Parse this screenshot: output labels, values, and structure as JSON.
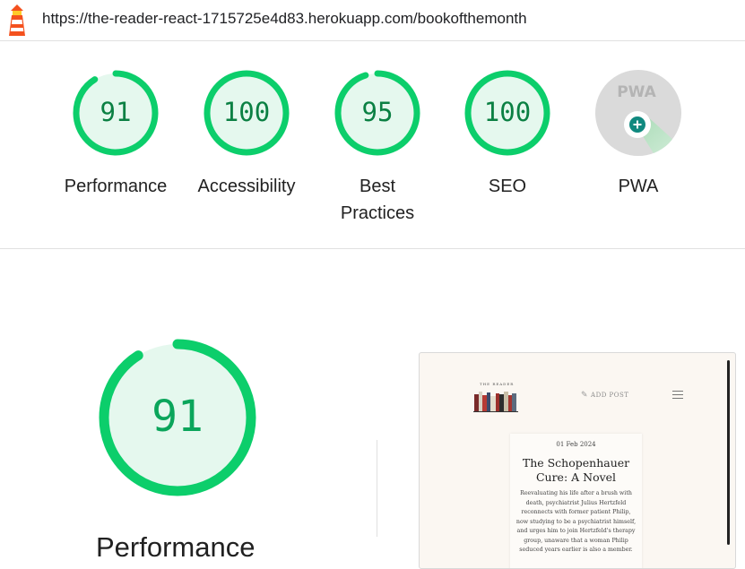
{
  "urlbar": {
    "logo_icon": "lighthouse-icon",
    "url": "https://the-reader-react-1715725e4d83.herokuapp.com/bookofthemonth"
  },
  "colors": {
    "pass_green": "#0cce6b",
    "pass_fill": "#e5f8ee",
    "pass_text": "#0b8043",
    "pwa_gray": "#dadada",
    "pwa_badge": "#10897f"
  },
  "gauges": [
    {
      "score": "91",
      "score_value": 91,
      "label": "Performance"
    },
    {
      "score": "100",
      "score_value": 100,
      "label": "Accessibility"
    },
    {
      "score": "95",
      "score_value": 95,
      "label": "Best Practices"
    },
    {
      "score": "100",
      "score_value": 100,
      "label": "SEO"
    },
    {
      "score": "",
      "label": "PWA",
      "badge_text": "PWA",
      "icon": "pwa-plus-icon"
    }
  ],
  "performance": {
    "score": "91",
    "score_value": 91,
    "title": "Performance"
  },
  "screenshot": {
    "brand": "THE READER",
    "add_post": "ADD POST",
    "add_post_icon": "feather-icon",
    "menu_icon": "hamburger-menu-icon",
    "date": "01 Feb 2024",
    "book_title": "The Schopenhauer Cure: A Novel",
    "excerpt": "Reevaluating his life after a brush with death, psychiatrist Julius Hertzfeld reconnects with former patient Philip, now studying to be a psychiatrist himself, and urges him to join Hertzfeld's therapy group, unaware that a woman Philip seduced years earlier is also a member."
  }
}
